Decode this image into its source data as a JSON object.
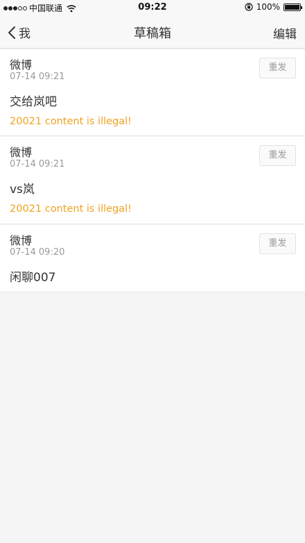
{
  "status_bar": {
    "carrier": "中国联通",
    "time": "09:22",
    "battery": "100%",
    "signal_bars_filled": 3,
    "signal_bars_total": 5
  },
  "nav": {
    "back_label": "我",
    "title": "草稿箱",
    "edit_label": "编辑"
  },
  "drafts": [
    {
      "source": "微博",
      "time": "07-14 09:21",
      "content": "交给岚吧",
      "error": "20021 content is illegal!",
      "resend_label": "重发"
    },
    {
      "source": "微博",
      "time": "07-14 09:21",
      "content": "vs岚",
      "error": "20021 content is illegal!",
      "resend_label": "重发"
    },
    {
      "source": "微博",
      "time": "07-14 09:20",
      "content": "闲聊007",
      "resend_label": "重发"
    }
  ],
  "colors": {
    "error_text": "#f0a21e",
    "background": "#f5f5f5"
  },
  "icons": [
    "wifi-icon",
    "rotation-lock-icon",
    "battery-icon",
    "back-chevron-icon"
  ]
}
